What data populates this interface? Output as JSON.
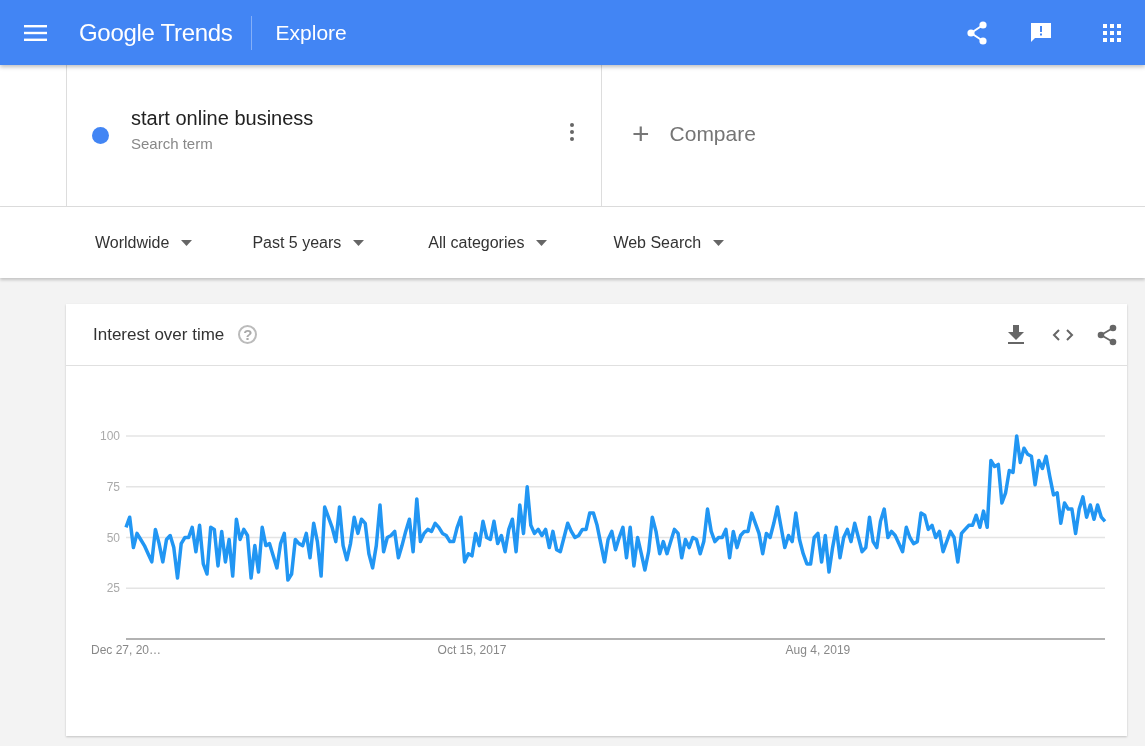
{
  "header": {
    "logo": "Google Trends",
    "title": "Explore"
  },
  "search_terms": [
    {
      "term": "start online business",
      "subtitle": "Search term",
      "color": "#4285f4"
    }
  ],
  "compare": {
    "icon": "+",
    "label": "Compare"
  },
  "filters": [
    {
      "label": "Worldwide"
    },
    {
      "label": "Past 5 years"
    },
    {
      "label": "All categories"
    },
    {
      "label": "Web Search"
    }
  ],
  "interest_over_time": {
    "title": "Interest over time",
    "help_icon": "?",
    "x_axis_labels": [
      "Dec 27, 20…",
      "Oct 15, 2017",
      "Aug 4, 2019"
    ],
    "chart_data": {
      "type": "line",
      "grid": true,
      "ylim": [
        0,
        100
      ],
      "yticks": [
        25,
        50,
        75,
        100
      ],
      "series": [
        {
          "color": "#2196f3",
          "values": [
            55,
            60,
            45,
            52,
            49,
            46,
            42,
            38,
            54,
            47,
            38,
            49,
            51,
            45,
            30,
            47,
            50,
            50,
            55,
            43,
            56,
            37,
            32,
            55,
            54,
            36,
            53,
            38,
            49,
            31,
            59,
            49,
            54,
            51,
            30,
            46,
            33,
            55,
            46,
            47,
            41,
            35,
            47,
            52,
            29,
            32,
            49,
            47,
            46,
            52,
            40,
            57,
            48,
            31,
            65,
            60,
            55,
            48,
            65,
            46,
            39,
            47,
            60,
            52,
            59,
            57,
            42,
            35,
            46,
            66,
            43,
            50,
            51,
            53,
            40,
            46,
            53,
            59,
            43,
            69,
            48,
            52,
            54,
            53,
            57,
            55,
            52,
            51,
            48,
            48,
            55,
            60,
            38,
            42,
            41,
            52,
            46,
            58,
            50,
            49,
            58,
            47,
            51,
            43,
            54,
            59,
            43,
            66,
            52,
            75,
            56,
            52,
            54,
            51,
            54,
            45,
            53,
            44,
            43,
            50,
            57,
            53,
            50,
            51,
            54,
            54,
            62,
            62,
            56,
            47,
            38,
            49,
            53,
            44,
            50,
            55,
            40,
            55,
            36,
            50,
            42,
            34,
            43,
            60,
            53,
            42,
            48,
            42,
            48,
            54,
            52,
            40,
            49,
            45,
            50,
            49,
            42,
            48,
            64,
            53,
            48,
            50,
            50,
            54,
            40,
            53,
            45,
            51,
            53,
            53,
            62,
            57,
            52,
            42,
            52,
            50,
            57,
            65,
            55,
            45,
            51,
            48,
            62,
            49,
            42,
            37,
            37,
            50,
            52,
            38,
            51,
            33,
            45,
            55,
            40,
            50,
            54,
            48,
            57,
            50,
            43,
            45,
            60,
            48,
            45,
            58,
            64,
            50,
            53,
            51,
            47,
            43,
            55,
            50,
            47,
            48,
            62,
            61,
            54,
            56,
            50,
            53,
            43,
            48,
            53,
            50,
            38,
            52,
            54,
            56,
            56,
            61,
            55,
            63,
            55,
            88,
            85,
            86,
            67,
            72,
            83,
            82,
            100,
            87,
            94,
            91,
            90,
            76,
            88,
            84,
            90,
            80,
            71,
            72,
            57,
            67,
            64,
            64,
            52,
            64,
            70,
            60,
            66,
            59,
            66,
            60,
            58
          ]
        }
      ]
    }
  }
}
